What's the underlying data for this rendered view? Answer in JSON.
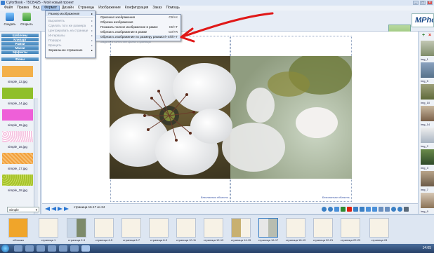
{
  "window": {
    "title": "CyforBook - T5CB425 - Мой новый проект",
    "min": "_",
    "max": "□",
    "close": "×"
  },
  "menu": {
    "items": [
      "Файл",
      "Правка",
      "Вид",
      "Формат",
      "Дизайн",
      "Страницы",
      "Изображение",
      "Конфигурация",
      "Заказ",
      "Помощь"
    ],
    "active_index": 3
  },
  "format_menu": {
    "items": [
      {
        "label": "Размер изображения",
        "submenu": true,
        "disabled": false
      },
      {
        "label": "Выровнять",
        "submenu": true,
        "disabled": true
      },
      {
        "label": "Сделать того же размера",
        "submenu": true,
        "disabled": true
      },
      {
        "label": "Центрировать на странице",
        "submenu": true,
        "disabled": true
      },
      {
        "label": "Интервалы",
        "submenu": true,
        "disabled": true
      },
      {
        "label": "Порядок",
        "submenu": true,
        "disabled": true
      },
      {
        "label": "Вращать",
        "submenu": true,
        "disabled": true
      },
      {
        "label": "Зеркальное отражение",
        "submenu": true,
        "disabled": false
      }
    ]
  },
  "image_size_submenu": {
    "items": [
      {
        "label": "Оригинал изображения",
        "shortcut": "Ctrl+K",
        "disabled": false
      },
      {
        "label": "Обрезка изображения",
        "shortcut": "",
        "disabled": false
      },
      {
        "label": "Показать полное изображение в рамке",
        "shortcut": "Ctrl+T",
        "disabled": false
      },
      {
        "label": "Обрезать изображение в рамке",
        "shortcut": "Ctrl+R",
        "disabled": false
      },
      {
        "label": "Обрезать изображение по размеру рамки",
        "shortcut": "Ctrl+Shift+T",
        "disabled": false
      },
      {
        "label": "Задать в качестве фона страницы",
        "shortcut": "",
        "disabled": true
      }
    ]
  },
  "toolbar": {
    "create_label": "Создать",
    "open_label": "Открыть",
    "brand_text": "MPhoto",
    "ad_text": "www.cyfor.com"
  },
  "left_panel": {
    "categories": [
      "Шаблоны",
      "Клипарт",
      "Рамки",
      "Маски",
      "Эффекты",
      "Фоны"
    ],
    "backgrounds": [
      {
        "label": "simple_13.jpg",
        "color": "#f3b04a"
      },
      {
        "label": "simple_14.jpg",
        "color": "#8fbf2a"
      },
      {
        "label": "simple_15.jpg",
        "color": "#ee5fd8"
      },
      {
        "label": "simple_16.jpg",
        "color": "#f6c6e2"
      },
      {
        "label": "simple_17.jpg",
        "color": "#f2a03c"
      },
      {
        "label": "simple_18.jpg",
        "color": "#a6c22a"
      }
    ],
    "dropdown_value": "Simple"
  },
  "canvas": {
    "safe_area_label": "Безопасная область"
  },
  "nav": {
    "page_info": "страница 16-17 из 24"
  },
  "right_panel": {
    "images": [
      "img_1",
      "img_5",
      "img_10",
      "img_14",
      "img_2",
      "img_3",
      "img_7",
      "img_9"
    ]
  },
  "filmstrip": {
    "pages": [
      "обложка",
      "страница 1",
      "страница 2-3",
      "страница 4-5",
      "страница 6-7",
      "страница 8-9",
      "страница 10-11",
      "страница 12-13",
      "страница 14-15",
      "страница 16-17",
      "страница 18-19",
      "страница 20-21",
      "страница 22-23",
      "страница 24"
    ]
  },
  "taskbar": {
    "clock": "14:05"
  },
  "colors": {
    "accent": "#3a7fc4",
    "arrow": "#e01818"
  }
}
